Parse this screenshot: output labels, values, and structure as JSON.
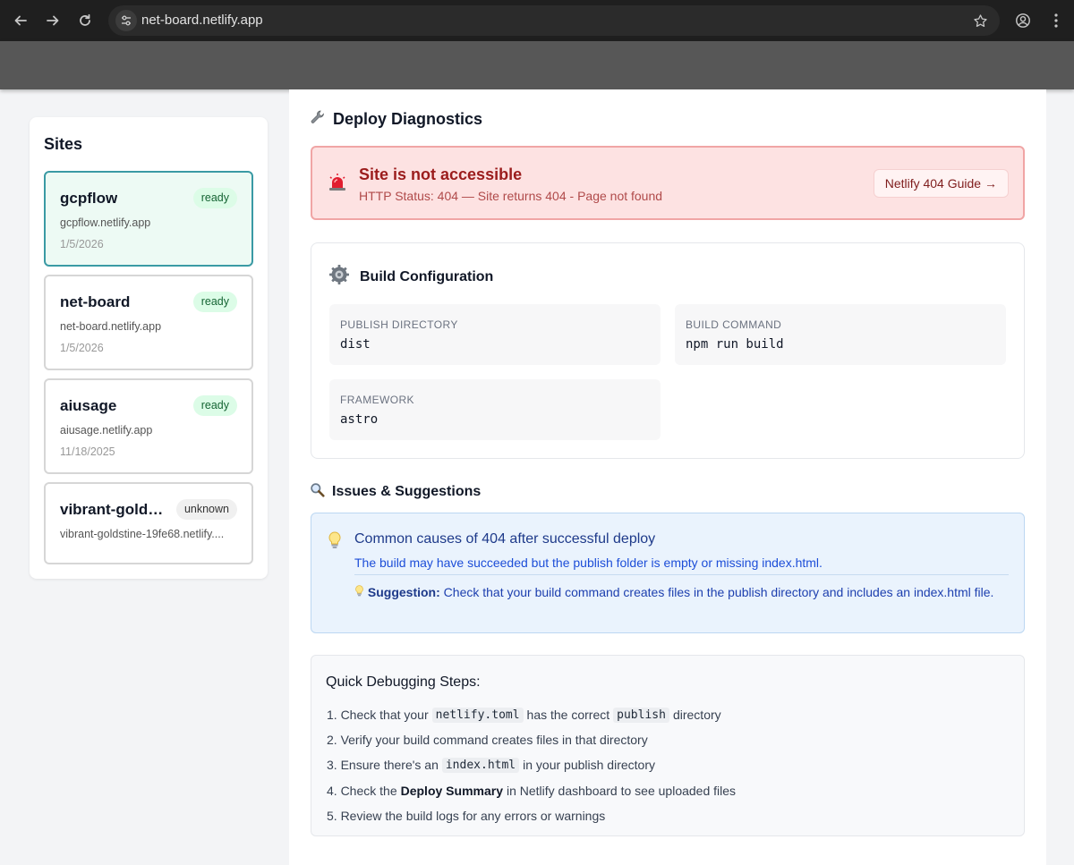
{
  "browser": {
    "url": "net-board.netlify.app"
  },
  "sidebar": {
    "title": "Sites",
    "sites": [
      {
        "name": "gcpflow",
        "status": "ready",
        "url": "gcpflow.netlify.app",
        "date": "1/5/2026"
      },
      {
        "name": "net-board",
        "status": "ready",
        "url": "net-board.netlify.app",
        "date": "1/5/2026"
      },
      {
        "name": "aiusage",
        "status": "ready",
        "url": "aiusage.netlify.app",
        "date": "11/18/2025"
      },
      {
        "name": "vibrant-golds...",
        "status": "unknown",
        "url": "vibrant-goldstine-19fe68.netlify....",
        "date": ""
      }
    ]
  },
  "main": {
    "title": "Deploy Diagnostics",
    "alert": {
      "title": "Site is not accessible",
      "subtitle": "HTTP Status: 404 — Site returns 404 - Page not found",
      "button": "Netlify 404 Guide →"
    },
    "config": {
      "title": "Build Configuration",
      "publish_label": "PUBLISH DIRECTORY",
      "publish_value": "dist",
      "command_label": "BUILD COMMAND",
      "command_value": "npm run build",
      "framework_label": "FRAMEWORK",
      "framework_value": "astro"
    },
    "issues": {
      "title": "Issues & Suggestions",
      "tip_title": "Common causes of 404 after successful deploy",
      "tip_desc": "The build may have succeeded but the publish folder is empty or missing index.html.",
      "suggestion_label": "Suggestion:",
      "suggestion_text": "Check that your build command creates files in the publish directory and includes an index.html file."
    },
    "steps": {
      "title": "Quick Debugging Steps:",
      "s1_a": "1. Check that your",
      "s1_code1": "netlify.toml",
      "s1_b": "has the correct",
      "s1_code2": "publish",
      "s1_c": "directory",
      "s2": "2. Verify your build command creates files in that directory",
      "s3_a": "3. Ensure there's an",
      "s3_code": "index.html",
      "s3_b": "in your publish directory",
      "s4_a": "4. Check the",
      "s4_bold": "Deploy Summary",
      "s4_b": "in Netlify dashboard to see uploaded files",
      "s5": "5. Review the build logs for any errors or warnings"
    }
  }
}
